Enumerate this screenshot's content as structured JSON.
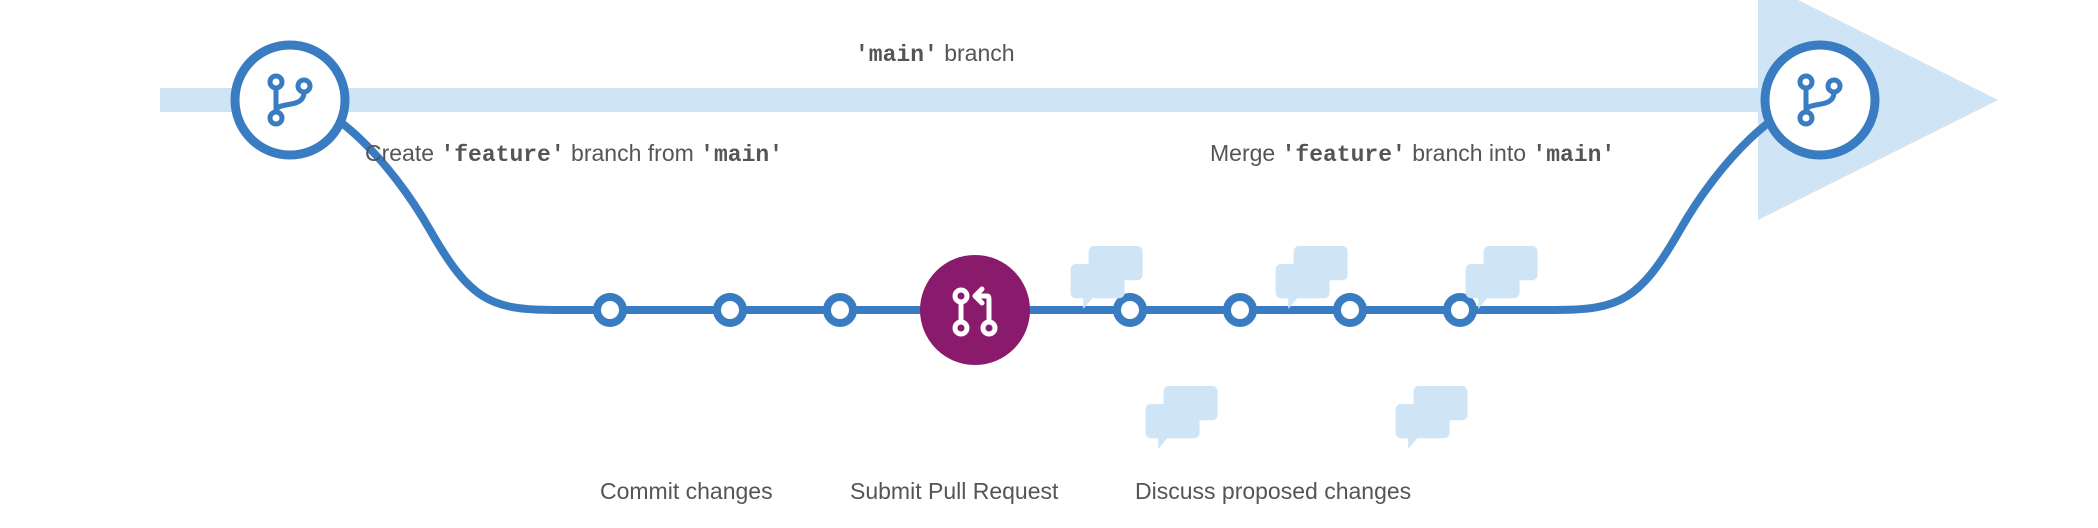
{
  "colors": {
    "main_branch_line": "#cfe4f5",
    "feature_line": "#3a7cc1",
    "node_fill": "#ffffff",
    "pr_node": "#8a1a6b",
    "speech": "#cfe4f5",
    "text": "#555555"
  },
  "main_branch_label": {
    "quoted": "'main'",
    "suffix": " branch"
  },
  "create_label": {
    "prefix": "Create ",
    "quoted1": "'feature'",
    "mid": " branch from ",
    "quoted2": "'main'"
  },
  "merge_label": {
    "prefix": "Merge ",
    "quoted1": "'feature'",
    "mid": " branch into ",
    "quoted2": "'main'"
  },
  "steps": {
    "commit": "Commit changes",
    "submit": "Submit Pull Request",
    "discuss": "Discuss proposed changes"
  },
  "icons": {
    "branch_start": "git-branch-icon",
    "branch_end": "git-branch-icon",
    "pull_request": "git-pull-request-icon",
    "speech": "speech-bubble-icon"
  }
}
